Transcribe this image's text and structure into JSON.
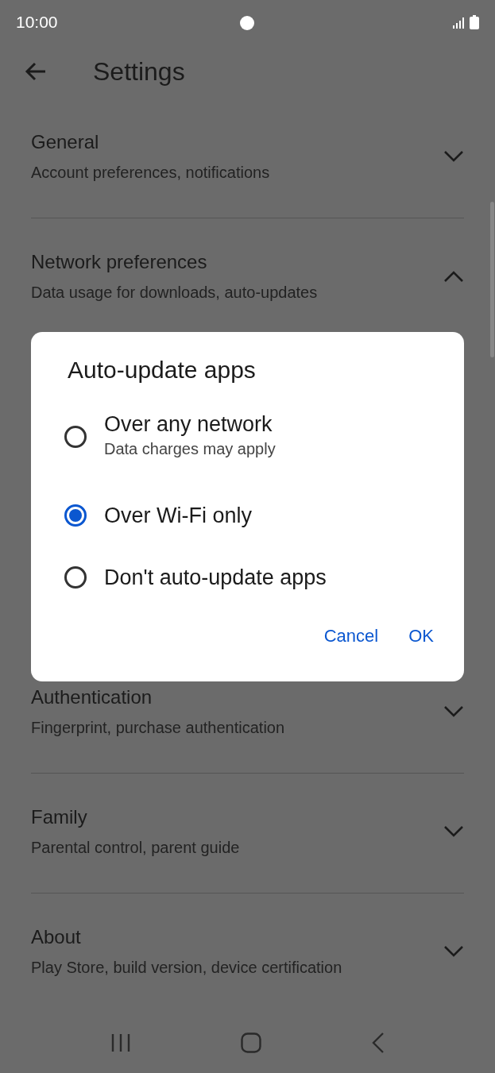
{
  "status_bar": {
    "time": "10:00"
  },
  "header": {
    "title": "Settings"
  },
  "sections": [
    {
      "title": "General",
      "subtitle": "Account preferences, notifications",
      "expanded": false
    },
    {
      "title": "Network preferences",
      "subtitle": "Data usage for downloads, auto-updates",
      "expanded": true
    },
    {
      "title": "Authentication",
      "subtitle": "Fingerprint, purchase authentication",
      "expanded": false
    },
    {
      "title": "Family",
      "subtitle": "Parental control, parent guide",
      "expanded": false
    },
    {
      "title": "About",
      "subtitle": "Play Store, build version, device certification",
      "expanded": false
    }
  ],
  "dialog": {
    "title": "Auto-update apps",
    "options": [
      {
        "label": "Over any network",
        "detail": "Data charges may apply",
        "selected": false
      },
      {
        "label": "Over Wi-Fi only",
        "selected": true
      },
      {
        "label": "Don't auto-update apps",
        "selected": false
      }
    ],
    "buttons": [
      "Cancel",
      "OK"
    ]
  }
}
